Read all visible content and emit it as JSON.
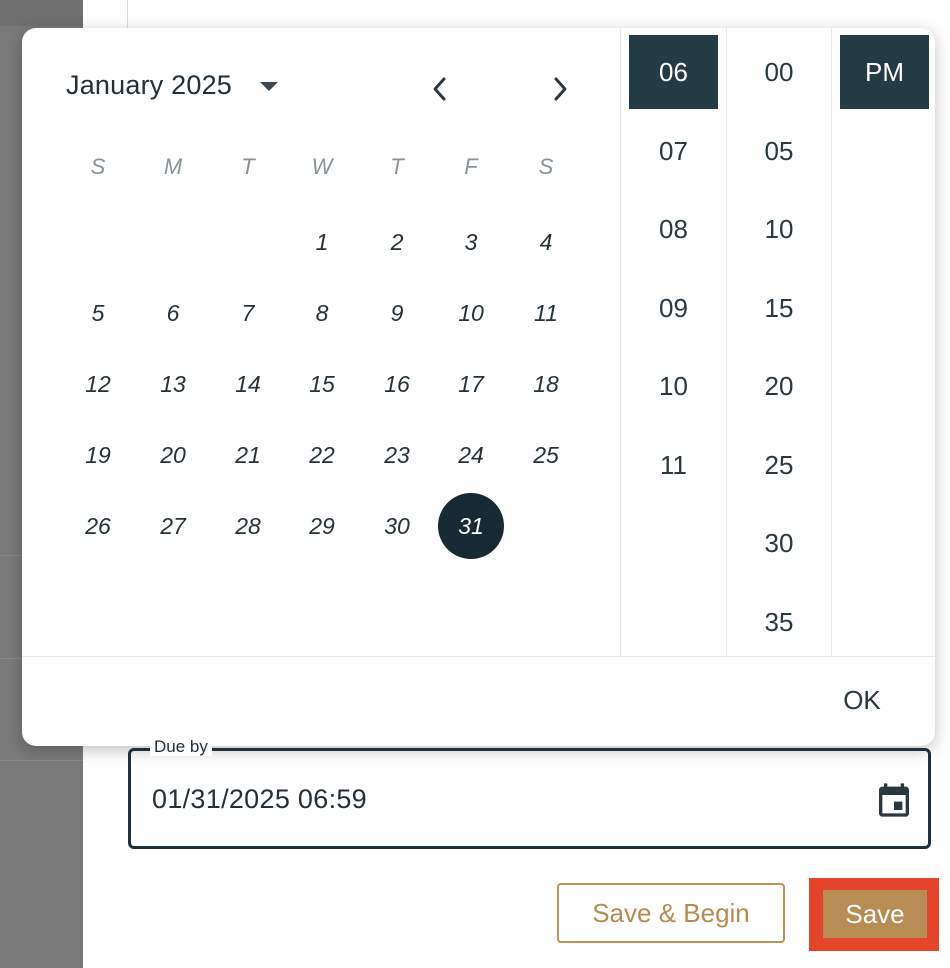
{
  "calendar": {
    "month_label": "January 2025",
    "weekdays": [
      "S",
      "M",
      "T",
      "W",
      "T",
      "F",
      "S"
    ],
    "days": [
      "1",
      "2",
      "3",
      "4",
      "5",
      "6",
      "7",
      "8",
      "9",
      "10",
      "11",
      "12",
      "13",
      "14",
      "15",
      "16",
      "17",
      "18",
      "19",
      "20",
      "21",
      "22",
      "23",
      "24",
      "25",
      "26",
      "27",
      "28",
      "29",
      "30",
      "31"
    ],
    "selected_day": "31"
  },
  "time": {
    "hours": [
      "06",
      "07",
      "08",
      "09",
      "10",
      "11"
    ],
    "selected_hour": "06",
    "minutes": [
      "00",
      "05",
      "10",
      "15",
      "20",
      "25",
      "30",
      "35"
    ],
    "selected_minute": "00",
    "ampm": [
      "PM"
    ],
    "selected_ampm": "PM"
  },
  "picker": {
    "ok_label": "OK"
  },
  "due_field": {
    "legend": "Due by",
    "value": "01/31/2025 06:59"
  },
  "actions": {
    "save_begin_label": "Save & Begin",
    "save_label": "Save"
  },
  "colors": {
    "selected_dark": "#172a33",
    "accent": "#b88c55",
    "highlight_outline": "#e4442a"
  },
  "icons": {
    "prev": "chevron-left-icon",
    "next": "chevron-right-icon",
    "dropdown": "caret-down-icon",
    "calendar": "calendar-icon"
  }
}
